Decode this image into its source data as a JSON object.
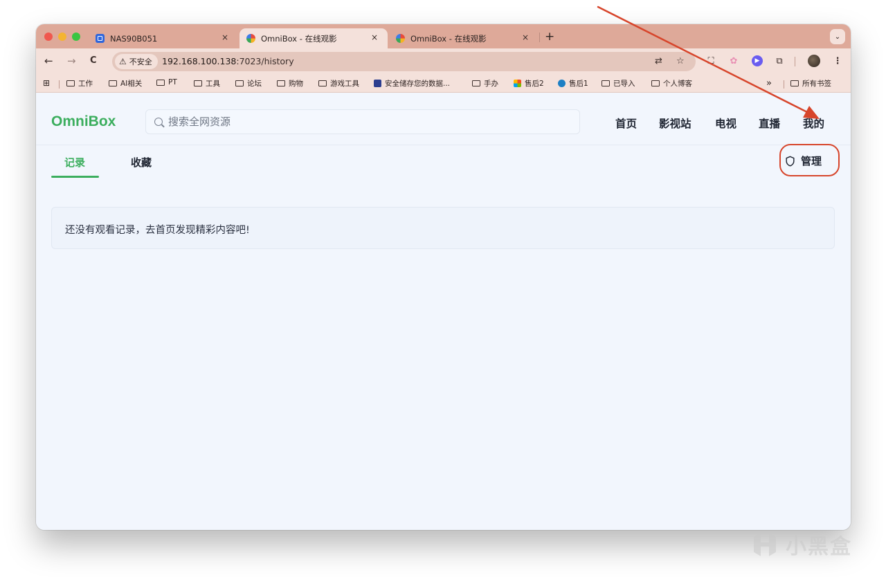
{
  "browser": {
    "tabs": [
      {
        "title": "NAS90B051",
        "active": false,
        "favicon": "nas-app-icon",
        "close": "×"
      },
      {
        "title": "OmniBox - 在线观影",
        "active": true,
        "favicon": "omnibox-icon",
        "close": "×"
      },
      {
        "title": "OmniBox - 在线观影",
        "active": false,
        "favicon": "omnibox-icon",
        "close": "×"
      }
    ],
    "new_tab": "+",
    "tab_menu": "⌄",
    "nav": {
      "back": "←",
      "forward": "→",
      "reload": "C"
    },
    "security_chip": {
      "icon": "⚠",
      "label": "不安全"
    },
    "url": {
      "host": "192.168.100.138",
      "rest": ":7023/history"
    },
    "bookmarks": [
      {
        "label": "工作",
        "type": "folder"
      },
      {
        "label": "AI相关",
        "type": "folder"
      },
      {
        "label": "PT",
        "type": "folder"
      },
      {
        "label": "工具",
        "type": "folder"
      },
      {
        "label": "论坛",
        "type": "folder"
      },
      {
        "label": "购物",
        "type": "folder"
      },
      {
        "label": "游戏工具",
        "type": "folder"
      },
      {
        "label": "安全储存您的数据...",
        "type": "site",
        "color": "#2c3e8f"
      },
      {
        "label": "手办",
        "type": "folder"
      },
      {
        "label": "售后2",
        "type": "site",
        "color": "#f25022"
      },
      {
        "label": "售后1",
        "type": "site",
        "color": "#1d7fc4"
      },
      {
        "label": "已导入",
        "type": "folder"
      },
      {
        "label": "个人博客",
        "type": "folder"
      }
    ],
    "bookmarks_overflow": "»",
    "all_bookmarks": "所有书签"
  },
  "app": {
    "logo": "OmniBox",
    "search_placeholder": "搜索全网资源",
    "nav": [
      "首页",
      "影视站",
      "电视",
      "直播",
      "我的"
    ],
    "tabs": [
      {
        "label": "记录",
        "active": true
      },
      {
        "label": "收藏",
        "active": false
      }
    ],
    "admin_label": "管理",
    "empty_message": "还没有观看记录，去首页发现精彩内容吧!"
  },
  "watermark": "小黑盒",
  "colors": {
    "accent": "#3cae5e",
    "annotation": "#d7452b",
    "tab_strip": "#dea999",
    "toolbar": "#f4e1db",
    "page_bg": "#f2f6fd"
  }
}
